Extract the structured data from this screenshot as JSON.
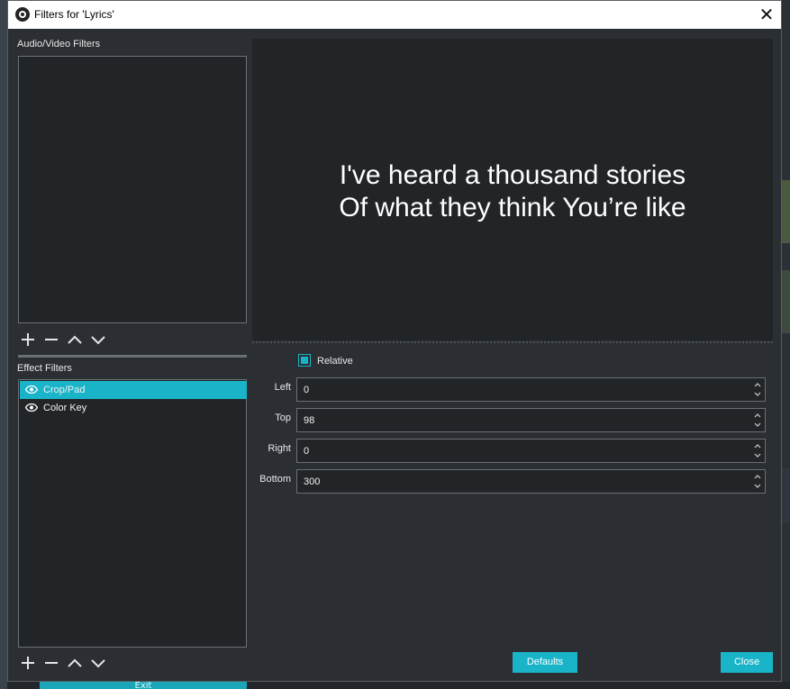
{
  "window": {
    "title": "Filters for 'Lyrics'"
  },
  "audio_video_filters": {
    "label": "Audio/Video Filters",
    "items": []
  },
  "effect_filters": {
    "label": "Effect Filters",
    "items": [
      {
        "label": "Crop/Pad",
        "selected": true,
        "visible": true
      },
      {
        "label": "Color Key",
        "selected": false,
        "visible": true
      }
    ]
  },
  "preview": {
    "lines": [
      "I've heard a thousand stories",
      "Of what they think You’re like"
    ]
  },
  "properties": {
    "relative": {
      "label": "Relative",
      "checked": true
    },
    "fields": [
      {
        "label": "Left",
        "value": "0"
      },
      {
        "label": "Top",
        "value": "98"
      },
      {
        "label": "Right",
        "value": "0"
      },
      {
        "label": "Bottom",
        "value": "300"
      }
    ]
  },
  "buttons": {
    "defaults": "Defaults",
    "close": "Close"
  },
  "background": {
    "exit_label": "Exit"
  },
  "colors": {
    "accent": "#19b4c8",
    "dialog_bg": "#2b2e32",
    "panel_bg": "#222528"
  },
  "icons": [
    "obs-logo-icon",
    "close-icon",
    "add-icon",
    "remove-icon",
    "move-up-icon",
    "move-down-icon",
    "eye-icon",
    "spin-up-icon",
    "spin-down-icon"
  ]
}
